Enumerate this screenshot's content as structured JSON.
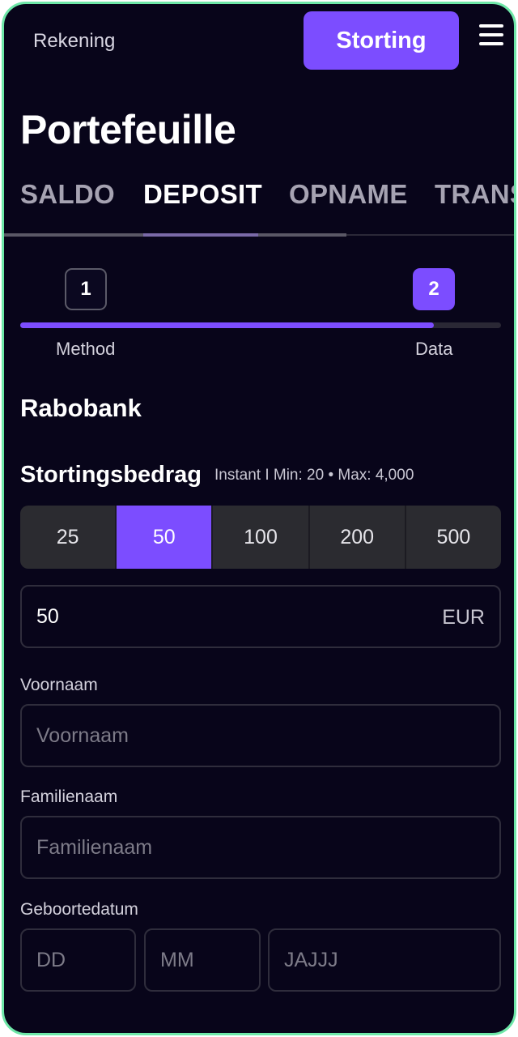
{
  "header": {
    "account_label": "Rekening",
    "deposit_button": "Storting",
    "menu_icon": "hamburger-menu-icon"
  },
  "page_title": "Portefeuille",
  "tabs": [
    {
      "label": "SALDO",
      "active": false
    },
    {
      "label": "DEPOSIT",
      "active": true
    },
    {
      "label": "OPNAME",
      "active": false
    },
    {
      "label": "TRANS",
      "active": false
    }
  ],
  "stepper": {
    "steps": [
      {
        "number": "1",
        "label": "Method",
        "current": false
      },
      {
        "number": "2",
        "label": "Data",
        "current": true
      }
    ],
    "progress": 0.86
  },
  "bank_name": "Rabobank",
  "amount_section": {
    "title": "Stortingsbedrag",
    "limits": "Instant I Min: 20 • Max: 4,000",
    "options": [
      "25",
      "50",
      "100",
      "200",
      "500"
    ],
    "selected": "50",
    "input_value": "50",
    "currency": "EUR"
  },
  "form": {
    "first_name": {
      "label": "Voornaam",
      "placeholder": "Voornaam"
    },
    "last_name": {
      "label": "Familienaam",
      "placeholder": "Familienaam"
    },
    "birthdate": {
      "label": "Geboortedatum",
      "day_placeholder": "DD",
      "month_placeholder": "MM",
      "year_placeholder": "JAJJJ"
    }
  },
  "colors": {
    "background": "#08051a",
    "accent": "#7c4dff",
    "frame_border": "#6ee7a8"
  }
}
